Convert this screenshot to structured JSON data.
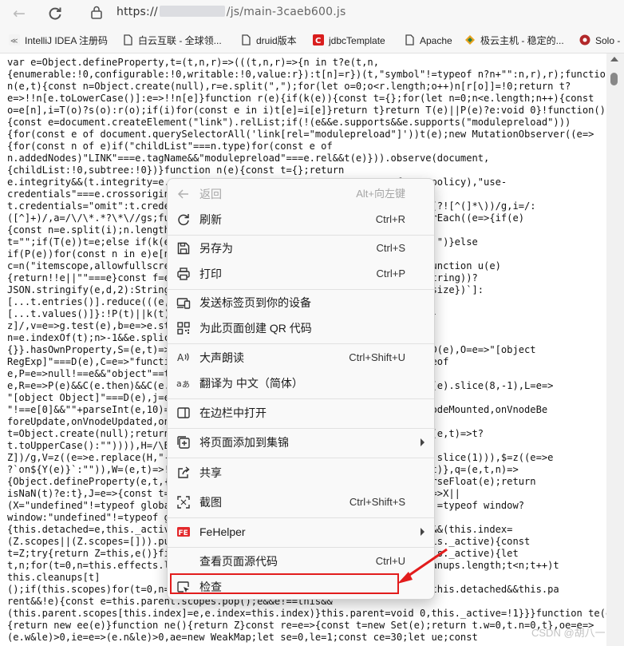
{
  "browser": {
    "url_prefix": "https://",
    "url_suffix": "/js/main-3caeb600.js"
  },
  "bookmarks": [
    {
      "label": "IntelliJ IDEA 注册码",
      "icon": "intellij-icon"
    },
    {
      "label": "白云互联 - 全球领...",
      "icon": "page-icon"
    },
    {
      "label": "druid版本",
      "icon": "page-icon"
    },
    {
      "label": "jdbcTemplate",
      "icon": "jdbc-icon"
    },
    {
      "label": "Apache",
      "icon": "page-icon"
    },
    {
      "label": "极云主机 - 稳定的...",
      "icon": "jiyun-icon"
    },
    {
      "label": "Solo -",
      "icon": "solo-icon"
    }
  ],
  "code_lines": [
    "var e=Object.defineProperty,t=(t,n,r)=>(((t,n,r)=>{n in t?e(t,n,",
    "{enumerable:!0,configurable:!0,writable:!0,value:r}):t[n]=r})(t,\"symbol\"!=typeof n?n+\"\":n,r),r);function",
    "n(e,t){const n=Object.create(null),r=e.split(\",\");for(let o=0;o<r.length;o++)n[r[o]]=!0;return t?",
    "e=>!!n[e.toLowerCase()]:e=>!!n[e]}function r(e){if(k(e)){const t={};for(let n=0;n<e.length;n++){const",
    "o=e[n],i=T(o)?s(o):r(o);if(i)for(const e in i)t[e]=i[e]}return t}return T(e)||P(e)?e:void 0}!function()",
    "{const e=document.createElement(\"link\").relList;if(!(e&&e.supports&&e.supports(\"modulepreload\")))",
    "{for(const e of document.querySelectorAll('link[rel=\"modulepreload\"]'))t(e);new MutationObserver((e=>",
    "{for(const n of e)if(\"childList\"===n.type)for(const e of",
    "n.addedNodes)\"LINK\"===e.tagName&&\"modulepreload\"===e.rel&&t(e)})).observe(document,",
    "{childList:!0,subtree:!0})}function n(e){const t={};return",
    "e.integrity&&(t.integrity=e.                                     referrerpolicy),\"use-",
    "credentials\"===e.crossorigin                                    igin?",
    "t.credentials=\"omit\":t.crede                                    onst o=/;(?![^(]*\\))/g,i=/:",
    "([^]+)/,a=/\\/\\*.*?\\*\\//gs;fu                                    lit(o).forEach((e=>{if(e)",
    "{const n=e.split(i);n.length                                     t(e){let",
    "t=\"\";if(T(e))t=e;else if(k(e                                     &(t+=r+\" \")}else",
    "if(P(e))for(const n in e)e[n                                     ",
    "c=n(\"itemscope,allowfullscre                                     only\");function u(e)",
    "{return!!e||\"\"===e}const f=e=                                    !C(e.toString))?",
    "JSON.stringify(e,d,2):String                                     Map(${t.size})`]:",
    "[...t.entries()].reduce(((e,                                     size})`]:",
    "[...t.values()]}:!P(t)||k(t)                                     =/^on[^a-",
    "z]/,v=e=>g.test(e),b=e=>e.st                                     const",
    "n=e.indexOf(t);n>-1&&e.splic                                     ",
    "{}}.hasOwnProperty,S=(e,t)=>S.call(e,t),k=Array.is               Set]\"===D(e),O=e=>\"[object",
    "RegExp]\"===D(e),C=e=>\"functi                                     ol\"==typeof",
    "e,P=e=>null!==e&&\"object\"==t                                     ",
    "e,R=e=>P(e)&&C(e.then)&&C(e.                                      ,I=e=>D(e).slice(8,-1),L=e=>",
    "\"[object Object]\"===D(e),j=e                                    ",
    "\"!==e[0]&&\"\"+parseInt(e,10)=                                    ount,onVnodeMounted,onVnodeBe",
    "foreUpdate,onVnodeUpdated,on                                      ",
    "t=Object.create(null);return                                      ace(U,((e,t)=>t?",
    "t.toUpperCase():\"\")))),H=/\\B                                    ",
    "Z])/g,V=z((e=>e.replace(H,\"-                                     Case()+e.slice(1))),$=z((e=>e",
    "?`on${Y(e)}`:\"\")),W=(e,t)=>!                                     ++)e[n](t)},q=(e,t,n)=>",
    "{Object.defineProperty(e,t,{                                     nst t=parseFloat(e);return",
    "isNaN(t)?e:t},J=e=>{const t=                                     nst Q=()=>X||",
    "(X=\"undefined\"!=typeof globa                                     defined\"!=typeof window?",
    "window:\"undefined\"!=typeof g                                     ",
    "{this.detached=e,this._activ                                     =Z,!e&&Z&&(this.index=",
    "(Z.scopes||(Z.scopes=[])).pu                                     e){if(this._active){const",
    "t=Z;try{return Z=this,e()}fi                                     e){if(this._active){let",
    "t,n;for(t=0,n=this.effects.l                                     this.cleanups.length;t<n;t++)t",
    "this.cleanups[t]",
    "();if(this.scopes)for(t=0,n=                                      0);if(!this.detached&&this.pa",
    "rent&&!e){const e=this.parent.scopes.pop();e&&e!==this&&",
    "(this.parent.scopes[this.index]=e,e.index=this.index)}this.parent=void 0,this._active=!1}}}function te(e)",
    "{return new ee(e)}function ne(){return Z}const re=e=>{const t=new Set(e);return t.w=0,t.n=0,t},oe=e=>",
    "(e.w&le)>0,ie=e=>(e.n&le)>0,ae=new WeakMap;let se=0,le=1;const ce=30;let ue;const"
  ],
  "context_menu": {
    "back": {
      "label": "返回",
      "shortcut": "Alt+向左键"
    },
    "refresh": {
      "label": "刷新",
      "shortcut": "Ctrl+R"
    },
    "save_as": {
      "label": "另存为",
      "shortcut": "Ctrl+S"
    },
    "print": {
      "label": "打印",
      "shortcut": "Ctrl+P"
    },
    "send_tab": {
      "label": "发送标签页到你的设备"
    },
    "qr_code": {
      "label": "为此页面创建 QR 代码"
    },
    "read_aloud": {
      "label": "大声朗读",
      "shortcut": "Ctrl+Shift+U"
    },
    "translate": {
      "label": "翻译为 中文（简体）"
    },
    "sidebar": {
      "label": "在边栏中打开"
    },
    "collections": {
      "label": "将页面添加到集锦"
    },
    "share": {
      "label": "共享"
    },
    "screenshot": {
      "label": "截图",
      "shortcut": "Ctrl+Shift+S"
    },
    "fehelper": {
      "label": "FeHelper"
    },
    "view_source": {
      "label": "查看页面源代码",
      "shortcut": "Ctrl+U"
    },
    "inspect": {
      "label": "检查"
    }
  },
  "annotation": {
    "color": "#e21c1c"
  },
  "watermark": "CSDN @胡八一"
}
